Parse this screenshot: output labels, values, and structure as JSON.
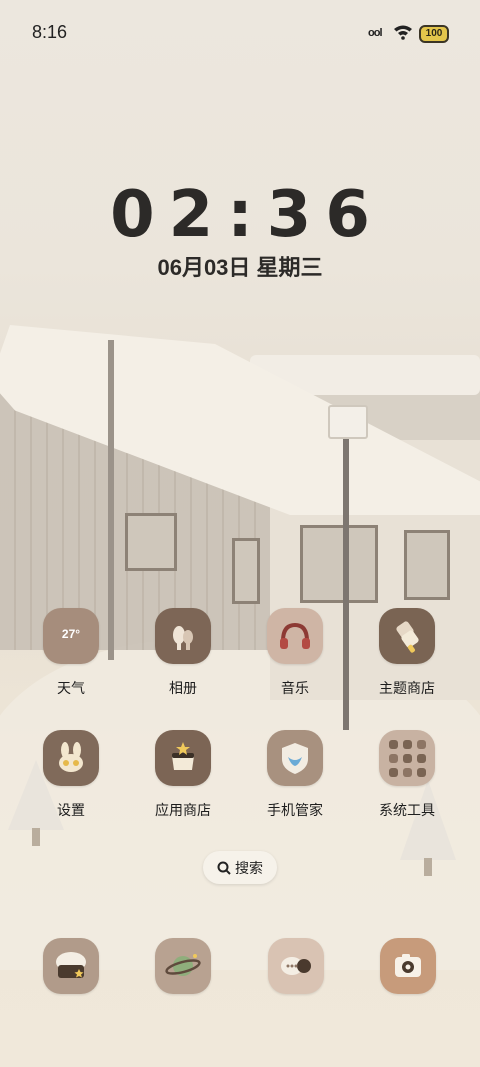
{
  "status_bar": {
    "time": "8:16",
    "signal_text": "ооl",
    "battery": "100"
  },
  "clock_widget": {
    "time": "02:36",
    "date": "06月03日 星期三"
  },
  "apps": [
    {
      "label": "天气",
      "icon": "weather-icon",
      "badge": "27°"
    },
    {
      "label": "相册",
      "icon": "gallery-icon"
    },
    {
      "label": "音乐",
      "icon": "music-icon"
    },
    {
      "label": "主题商店",
      "icon": "theme-store-icon"
    },
    {
      "label": "设置",
      "icon": "settings-icon"
    },
    {
      "label": "应用商店",
      "icon": "app-store-icon"
    },
    {
      "label": "手机管家",
      "icon": "phone-manager-icon"
    },
    {
      "label": "系统工具",
      "icon": "system-tools-folder-icon"
    }
  ],
  "search": {
    "label": "搜索"
  },
  "dock": [
    {
      "icon": "browser-icon"
    },
    {
      "icon": "planet-icon"
    },
    {
      "icon": "messages-icon"
    },
    {
      "icon": "camera-icon"
    }
  ],
  "colors": {
    "icon_dark": "#7b6656",
    "icon_mid": "#a89382",
    "icon_light": "#c9b3a3",
    "icon_pale": "#e3d2c4",
    "text_dark": "#2c2a28",
    "battery_yellow": "#e3c54b"
  }
}
